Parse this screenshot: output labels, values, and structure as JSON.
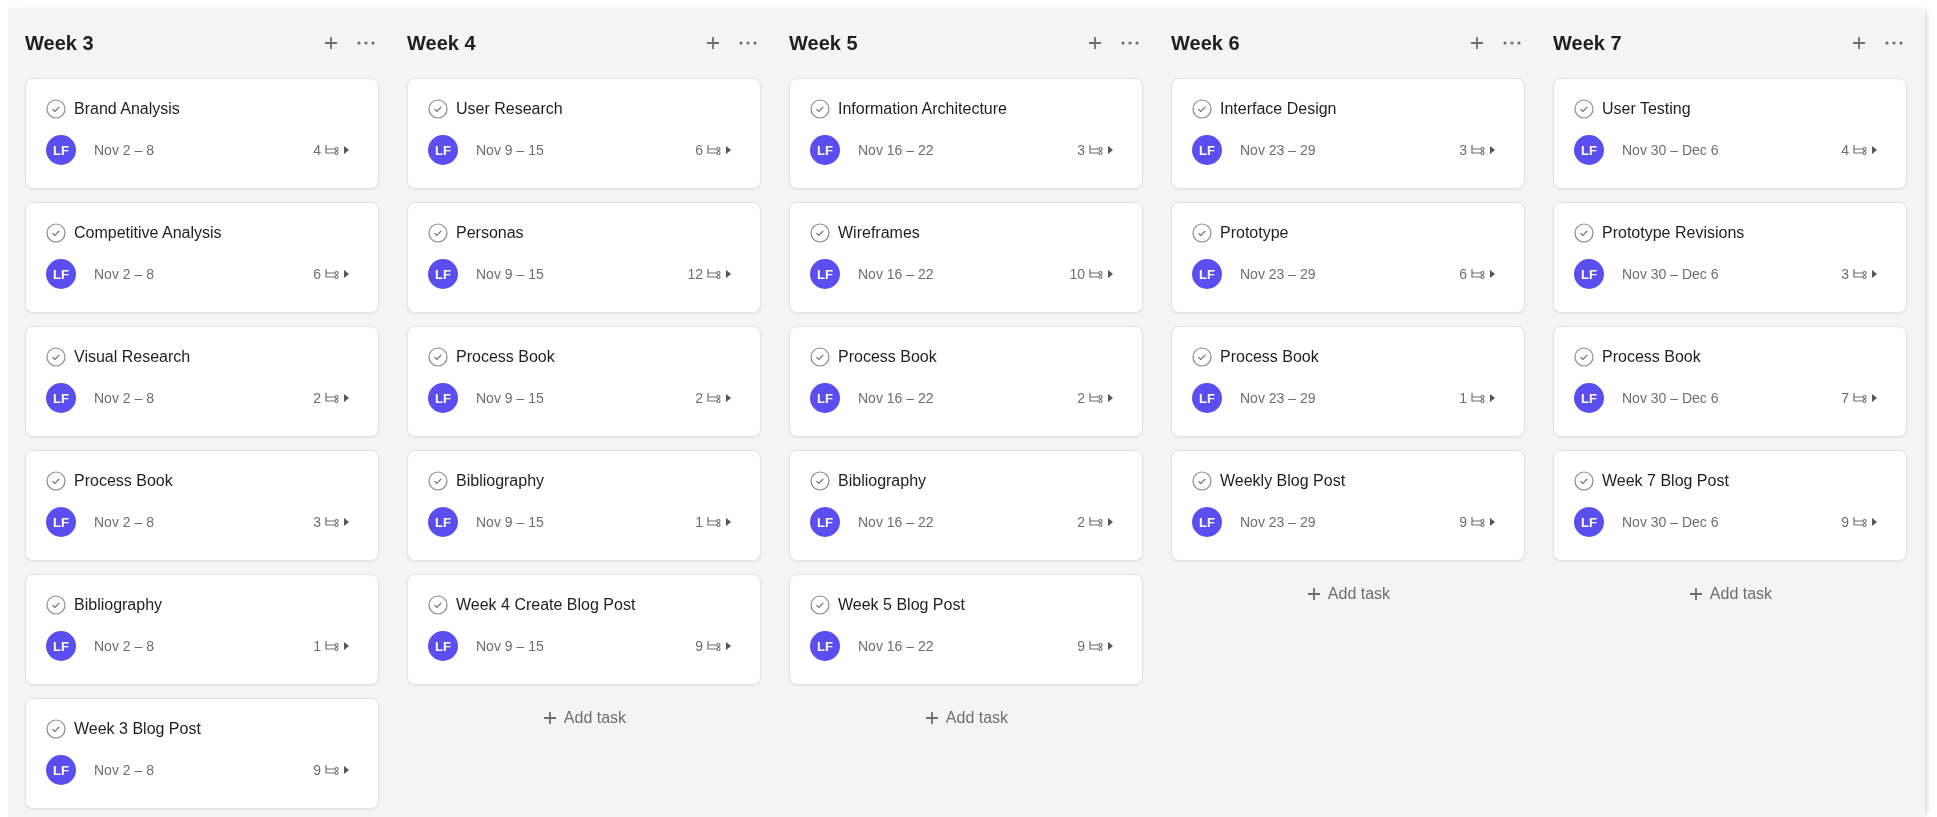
{
  "columns": [
    {
      "title": "Week 3",
      "tasks": [
        {
          "name": "Brand Analysis",
          "assignee": "LF",
          "dates": "Nov 2 – 8",
          "subtasks": "4"
        },
        {
          "name": "Competitive Analysis",
          "assignee": "LF",
          "dates": "Nov 2 – 8",
          "subtasks": "6"
        },
        {
          "name": "Visual Research",
          "assignee": "LF",
          "dates": "Nov 2 – 8",
          "subtasks": "2"
        },
        {
          "name": "Process Book",
          "assignee": "LF",
          "dates": "Nov 2 – 8",
          "subtasks": "3"
        },
        {
          "name": "Bibliography",
          "assignee": "LF",
          "dates": "Nov 2 – 8",
          "subtasks": "1"
        },
        {
          "name": "Week 3 Blog Post",
          "assignee": "LF",
          "dates": "Nov 2 – 8",
          "subtasks": "9"
        }
      ]
    },
    {
      "title": "Week 4",
      "add_task": "Add task",
      "tasks": [
        {
          "name": "User Research",
          "assignee": "LF",
          "dates": "Nov 9 – 15",
          "subtasks": "6"
        },
        {
          "name": "Personas",
          "assignee": "LF",
          "dates": "Nov 9 – 15",
          "subtasks": "12"
        },
        {
          "name": "Process Book",
          "assignee": "LF",
          "dates": "Nov 9 – 15",
          "subtasks": "2"
        },
        {
          "name": "Bibliography",
          "assignee": "LF",
          "dates": "Nov 9 – 15",
          "subtasks": "1"
        },
        {
          "name": "Week 4 Create Blog Post",
          "assignee": "LF",
          "dates": "Nov 9 – 15",
          "subtasks": "9"
        }
      ]
    },
    {
      "title": "Week 5",
      "add_task": "Add task",
      "tasks": [
        {
          "name": "Information Architecture",
          "assignee": "LF",
          "dates": "Nov 16 – 22",
          "subtasks": "3"
        },
        {
          "name": "Wireframes",
          "assignee": "LF",
          "dates": "Nov 16 – 22",
          "subtasks": "10"
        },
        {
          "name": "Process Book",
          "assignee": "LF",
          "dates": "Nov 16 – 22",
          "subtasks": "2"
        },
        {
          "name": "Bibliography",
          "assignee": "LF",
          "dates": "Nov 16 – 22",
          "subtasks": "2"
        },
        {
          "name": "Week 5 Blog Post",
          "assignee": "LF",
          "dates": "Nov 16 – 22",
          "subtasks": "9"
        }
      ]
    },
    {
      "title": "Week 6",
      "add_task": "Add task",
      "tasks": [
        {
          "name": "Interface Design",
          "assignee": "LF",
          "dates": "Nov 23 – 29",
          "subtasks": "3"
        },
        {
          "name": "Prototype",
          "assignee": "LF",
          "dates": "Nov 23 – 29",
          "subtasks": "6"
        },
        {
          "name": "Process Book",
          "assignee": "LF",
          "dates": "Nov 23 – 29",
          "subtasks": "1"
        },
        {
          "name": "Weekly Blog Post",
          "assignee": "LF",
          "dates": "Nov 23 – 29",
          "subtasks": "9"
        }
      ]
    },
    {
      "title": "Week 7",
      "add_task": "Add task",
      "tasks": [
        {
          "name": "User Testing",
          "assignee": "LF",
          "dates": "Nov 30 – Dec 6",
          "subtasks": "4"
        },
        {
          "name": "Prototype Revisions",
          "assignee": "LF",
          "dates": "Nov 30 – Dec 6",
          "subtasks": "3"
        },
        {
          "name": "Process Book",
          "assignee": "LF",
          "dates": "Nov 30 – Dec 6",
          "subtasks": "7"
        },
        {
          "name": "Week 7 Blog Post",
          "assignee": "LF",
          "dates": "Nov 30 – Dec 6",
          "subtasks": "9"
        }
      ]
    }
  ]
}
